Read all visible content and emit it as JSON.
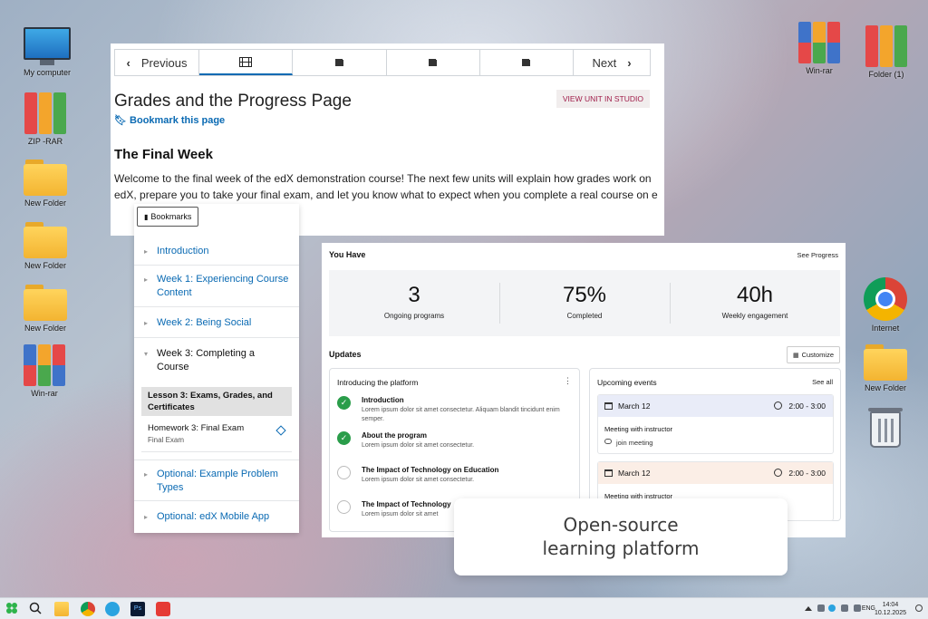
{
  "desktop": {
    "left_icons": [
      "My computer",
      "ZIP -RAR",
      "New Folder",
      "New Folder",
      "New Folder",
      "Win-rar"
    ],
    "right_icons": [
      "Win-rar",
      "Folder (1)",
      "Internet",
      "New Folder"
    ]
  },
  "course": {
    "nav": {
      "previous": "Previous",
      "next": "Next"
    },
    "title": "Grades and the Progress Page",
    "bookmark": "Bookmark this page",
    "studio_button": "VIEW UNIT IN STUDIO",
    "week_title": "The Final Week",
    "week_text": "Welcome to the final week of the edX demonstration course! The next few units will explain how grades work on edX, prepare you to take your final exam, and let you know what to expect when you complete a real course on e"
  },
  "outline": {
    "bookmarks_button": "Bookmarks",
    "items": [
      "Introduction",
      "Week 1: Experiencing Course Content",
      "Week 2: Being Social",
      "Week 3: Completing a Course",
      "Optional: Example Problem Types",
      "Optional: edX Mobile App"
    ],
    "subitems": [
      {
        "title": "Lesson 3: Exams, Grades, and Certificates",
        "subtitle": ""
      },
      {
        "title": "Homework 3: Final Exam",
        "subtitle": "Final Exam"
      }
    ]
  },
  "dashboard": {
    "heading": "You Have",
    "see_progress": "See Progress",
    "stats": [
      {
        "value": "3",
        "caption": "Ongoing programs"
      },
      {
        "value": "75%",
        "caption": "Completed"
      },
      {
        "value": "40h",
        "caption": "Weekly engagement"
      }
    ],
    "updates_title": "Updates",
    "customize": "Customize",
    "platform_card": {
      "title": "Introducing the platform",
      "tasks": [
        {
          "title": "Introduction",
          "desc": "Lorem ipsum dolor sit amet consectetur. Aliquam blandit tincidunt enim semper.",
          "done": true
        },
        {
          "title": "About the program",
          "desc": "Lorem ipsum dolor sit amet consectetur.",
          "done": true
        },
        {
          "title": "The Impact of Technology on Education",
          "desc": "Lorem ipsum dolor sit amet consectetur.",
          "done": false
        },
        {
          "title": "The Impact of Technology",
          "desc": "Lorem ipsum dolor sit amet",
          "done": false
        }
      ]
    },
    "events_card": {
      "title": "Upcoming events",
      "see_all": "See all",
      "events": [
        {
          "date": "March 12",
          "time": "2:00 - 3:00",
          "what": "Meeting with instructor",
          "link": "join meeting",
          "color": "#e9ecf8"
        },
        {
          "date": "March 12",
          "time": "2:00 - 3:00",
          "what": "Meeting with instructor",
          "link": "",
          "color": "#fbeee6"
        }
      ]
    }
  },
  "caption": {
    "line1": "Open-source",
    "line2": "learning platform"
  },
  "taskbar": {
    "lang": "ENG",
    "time": "14:04",
    "date": "10.12.2025"
  }
}
